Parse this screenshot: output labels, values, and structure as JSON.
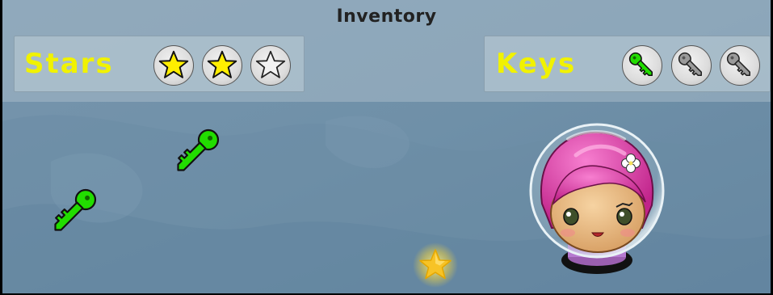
{
  "inventory": {
    "title": "Inventory",
    "stars": {
      "label": "Stars",
      "total": 3,
      "collected": 2
    },
    "keys": {
      "label": "Keys",
      "total": 3,
      "collected": 1
    }
  },
  "world": {
    "key_pickups": 2,
    "star_pickups": 1
  },
  "player": {
    "name_icon": "astronaut-girl-icon"
  },
  "colors": {
    "label_yellow": "#f1f200",
    "star_fill": "#ffee00",
    "key_green": "#22dd00",
    "key_grey": "#9a9a9a",
    "hair_pink": "#e23fa6"
  }
}
